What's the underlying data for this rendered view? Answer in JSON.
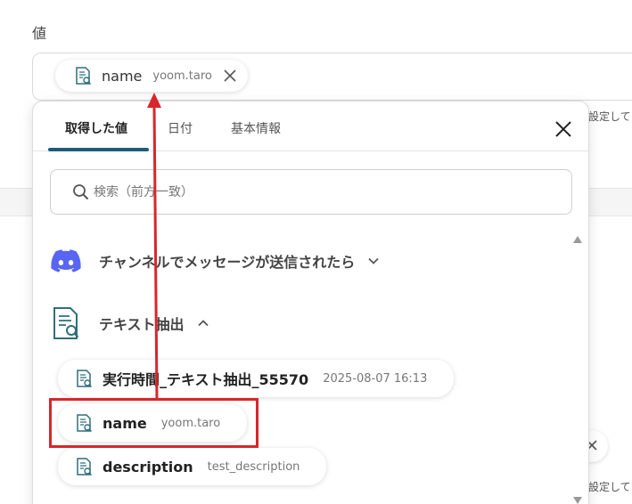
{
  "field": {
    "label": "値",
    "selected_chip": {
      "name": "name",
      "sub": "yoom.taro"
    }
  },
  "side": {
    "setting_text_1": "設定して",
    "setting_text_2": "設定して"
  },
  "popover": {
    "tabs": [
      {
        "label": "取得した値",
        "active": true
      },
      {
        "label": "日付",
        "active": false
      },
      {
        "label": "基本情報",
        "active": false
      }
    ],
    "search": {
      "placeholder": "検索（前方一致）",
      "value": ""
    },
    "sections": [
      {
        "title": "チャンネルでメッセージが送信されたら",
        "icon": "discord-icon",
        "expanded": false
      },
      {
        "title": "テキスト抽出",
        "icon": "document-search-icon",
        "expanded": true
      }
    ],
    "items": [
      {
        "name": "実行時間_テキスト抽出_55570",
        "sub": "2025-08-07 16:13"
      },
      {
        "name": "name",
        "sub": "yoom.taro"
      },
      {
        "name": "description",
        "sub": "test_description"
      }
    ]
  },
  "colors": {
    "accent": "#1c5c7b",
    "discord": "#5865f2",
    "annotation": "#d8262b"
  }
}
